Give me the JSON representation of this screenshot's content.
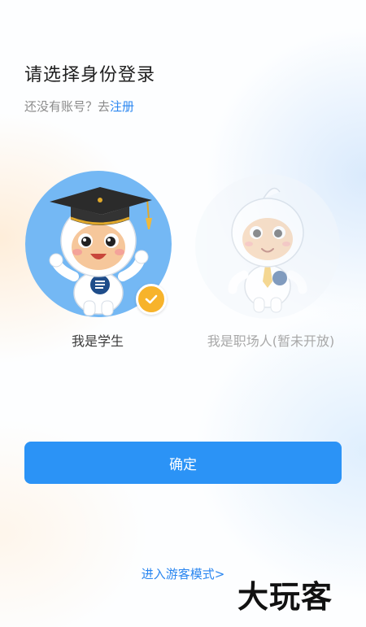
{
  "header": {
    "title": "请选择身份登录",
    "no_account_text": "还没有账号？去",
    "register_link": "注册"
  },
  "roles": [
    {
      "label": "我是学生",
      "selected": true,
      "icon": "student-mascot-icon"
    },
    {
      "label": "我是职场人(暂未开放)",
      "selected": false,
      "icon": "worker-mascot-icon"
    }
  ],
  "actions": {
    "confirm_label": "确定",
    "guest_label": "进入游客模式>"
  },
  "watermark": "大玩客",
  "colors": {
    "accent": "#2b93f6",
    "link": "#2a86f0",
    "check": "#f7b32b",
    "avatar_bg": "#74b8f4"
  }
}
